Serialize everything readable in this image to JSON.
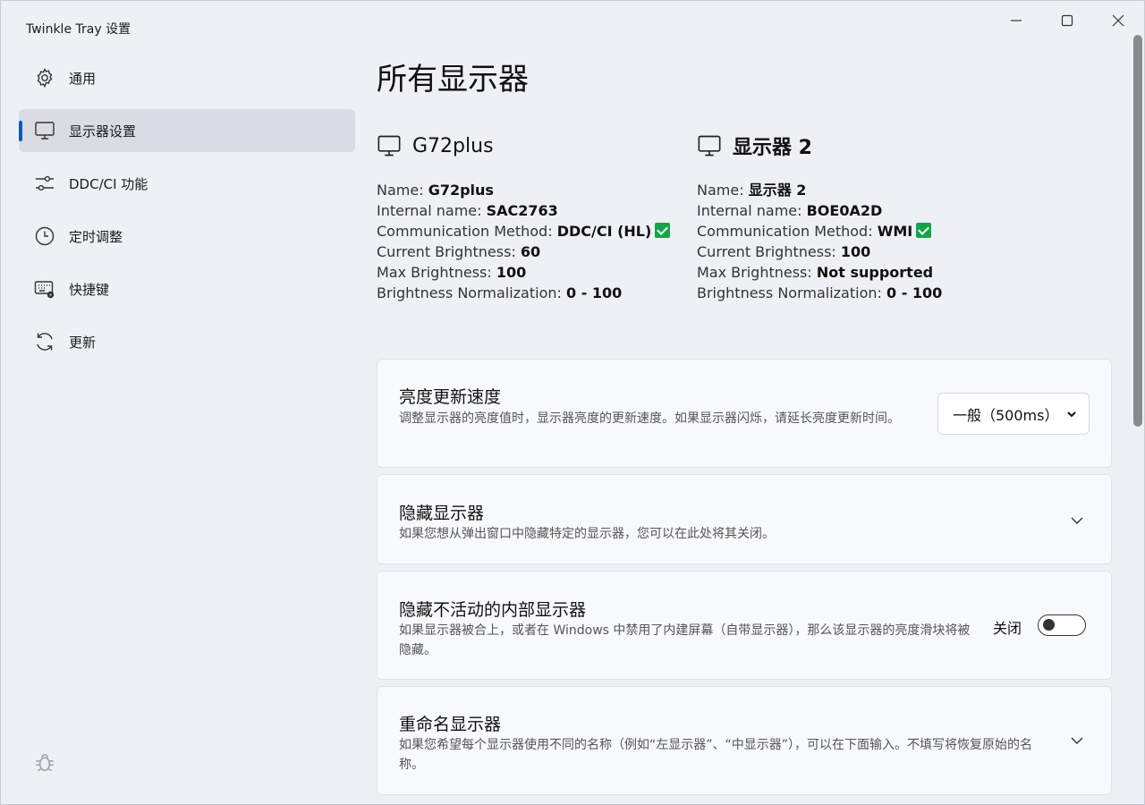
{
  "window": {
    "title": "Twinkle Tray 设置"
  },
  "sidebar": {
    "items": [
      {
        "label": "通用",
        "icon": "gear-icon"
      },
      {
        "label": "显示器设置",
        "icon": "monitor-icon",
        "active": true
      },
      {
        "label": "DDC/CI 功能",
        "icon": "sliders-icon"
      },
      {
        "label": "定时调整",
        "icon": "clock-icon"
      },
      {
        "label": "快捷键",
        "icon": "keyboard-gear-icon"
      },
      {
        "label": "更新",
        "icon": "refresh-icon"
      }
    ],
    "footer_icon": "bug-icon"
  },
  "main": {
    "title": "所有显示器",
    "monitors": [
      {
        "title": "G72plus",
        "labels": {
          "name": "Name: ",
          "internal": "Internal name: ",
          "method": "Communication Method: ",
          "current": "Current Brightness: ",
          "max": "Max Brightness: ",
          "norm": "Brightness Normalization: "
        },
        "name": "G72plus",
        "internal_name": "SAC2763",
        "method": "DDC/CI (HL)",
        "current_brightness": "60",
        "max_brightness": "100",
        "normalization": "0 - 100"
      },
      {
        "title": "显示器 2",
        "labels": {
          "name": "Name: ",
          "internal": "Internal name: ",
          "method": "Communication Method: ",
          "current": "Current Brightness: ",
          "max": "Max Brightness: ",
          "norm": "Brightness Normalization: "
        },
        "name": "显示器 2",
        "internal_name": "BOE0A2D",
        "method": "WMI",
        "current_brightness": "100",
        "max_brightness": "Not supported",
        "normalization": "0 - 100"
      }
    ],
    "cards": {
      "update_rate": {
        "title": "亮度更新速度",
        "desc": "调整显示器的亮度值时，显示器亮度的更新速度。如果显示器闪烁，请延长亮度更新时间。",
        "selected": "一般（500ms）"
      },
      "hide_displays": {
        "title": "隐藏显示器",
        "desc": "如果您想从弹出窗口中隐藏特定的显示器，您可以在此处将其关闭。"
      },
      "hide_internal": {
        "title": "隐藏不活动的内部显示器",
        "desc": "如果显示器被合上，或者在 Windows 中禁用了内建屏幕（自带显示器），那么该显示器的亮度滑块将被隐藏。",
        "toggle_label": "关闭",
        "toggle_on": false
      },
      "rename": {
        "title": "重命名显示器",
        "desc": "如果您希望每个显示器使用不同的名称（例如“左显示器”、“中显示器”），可以在下面输入。不填写将恢复原始的名称。"
      }
    }
  },
  "colors": {
    "accent": "#0a5bbd",
    "check": "#16a34a"
  }
}
